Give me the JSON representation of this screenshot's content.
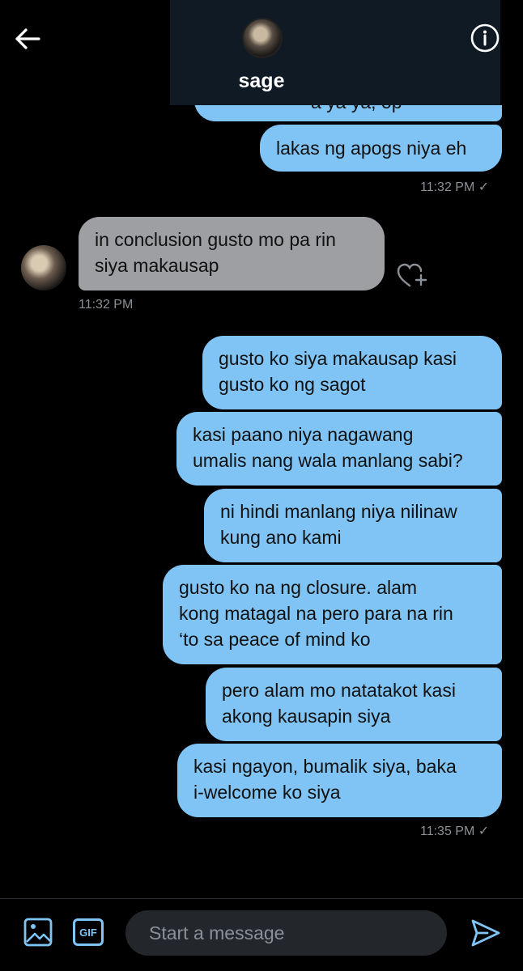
{
  "header": {
    "title": "sage"
  },
  "messages": {
    "partial_top": "a ya ya, op",
    "sent_1": "lakas ng apogs niya eh",
    "ts_1": "11:32 PM ✓",
    "recv_1_line1": "in conclusion gusto mo pa rin",
    "recv_1_line2": "siya makausap",
    "ts_2": "11:32 PM",
    "sent_2_line1": "gusto ko siya makausap kasi",
    "sent_2_line2": "gusto ko ng sagot",
    "sent_3_line1": "kasi paano niya nagawang",
    "sent_3_line2": "umalis nang wala manlang sabi?",
    "sent_4_line1": "ni hindi manlang niya nilinaw",
    "sent_4_line2": "kung ano kami",
    "sent_5_line1": "gusto ko na ng closure. alam",
    "sent_5_line2": "kong matagal na pero para na rin",
    "sent_5_line3": "‘to sa peace of mind ko",
    "sent_6_line1": "pero alam mo natatakot kasi",
    "sent_6_line2": "akong kausapin siya",
    "sent_7_line1": "kasi ngayon, bumalik siya, baka",
    "sent_7_line2": "i-welcome ko siya",
    "ts_3": "11:35 PM ✓"
  },
  "composer": {
    "placeholder": "Start a message",
    "gif_label": "GIF"
  },
  "colors": {
    "sent_bubble": "#7fc4f4",
    "received_bubble": "#9d9fa3",
    "accent": "#7fc4f4"
  },
  "icons": [
    "back-arrow-icon",
    "info-icon",
    "heart-plus-icon",
    "image-icon",
    "gif-icon",
    "send-icon"
  ]
}
